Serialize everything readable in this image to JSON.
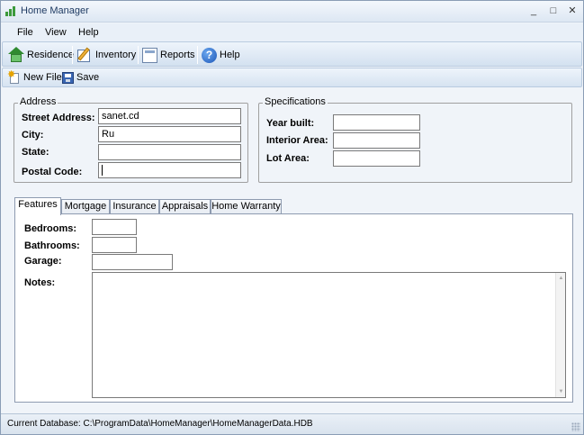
{
  "window": {
    "title": "Home Manager",
    "min": "_",
    "max": "□",
    "close": "✕"
  },
  "menu": [
    "File",
    "View",
    "Help"
  ],
  "toolbar": [
    {
      "label": "Residence",
      "icon": "house-icon"
    },
    {
      "label": "Inventory",
      "icon": "pencil-icon"
    },
    {
      "label": "Reports",
      "icon": "report-icon"
    },
    {
      "label": "Help",
      "icon": "help-icon"
    }
  ],
  "toolbar2": {
    "new_file": "New File",
    "save": "Save"
  },
  "address": {
    "legend": "Address",
    "street_label": "Street Address:",
    "street_value": "sanet.cd",
    "city_label": "City:",
    "city_value": "Ru",
    "state_label": "State:",
    "state_value": "",
    "postal_label": "Postal Code:",
    "postal_value": ""
  },
  "specifications": {
    "legend": "Specifications",
    "year_label": "Year built:",
    "year_value": "",
    "interior_label": "Interior Area:",
    "interior_value": "",
    "lot_label": "Lot Area:",
    "lot_value": ""
  },
  "tabs": [
    "Features",
    "Mortgage",
    "Insurance",
    "Appraisals",
    "Home Warranty"
  ],
  "active_tab": "Features",
  "features": {
    "bedrooms_label": "Bedrooms:",
    "bedrooms_value": "",
    "bathrooms_label": "Bathrooms:",
    "bathrooms_value": "",
    "garage_label": "Garage:",
    "garage_value": "",
    "notes_label": "Notes:",
    "notes_value": ""
  },
  "status": {
    "text": "Current Database: C:\\ProgramData\\HomeManager\\HomeManagerData.HDB"
  }
}
